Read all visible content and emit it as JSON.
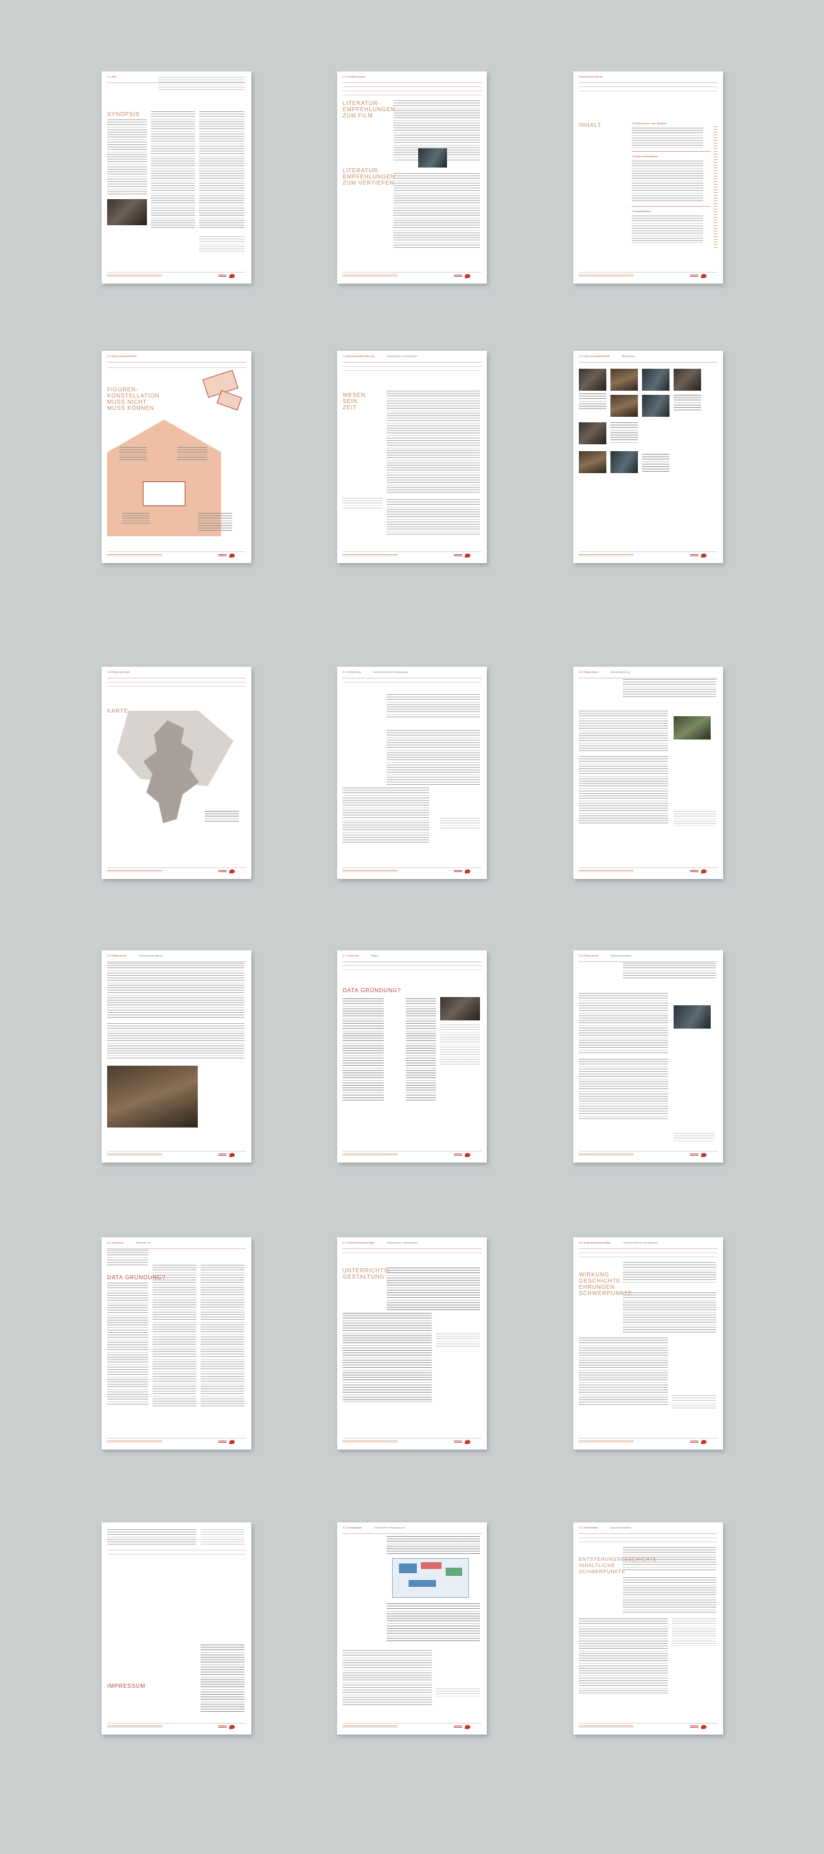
{
  "pages": [
    {
      "header": "1.1 Plot",
      "title": "SYNOPSIS",
      "title_color": "#c58a66"
    },
    {
      "header": "1.2 Empfehlungen",
      "title": "LITERATUR-\nEMPFEHLUNGEN\nZUM FILM",
      "title2": "LITERATUR-\nEMPFEHLUNGEN\nZUM VERTIEFEN"
    },
    {
      "header": "Unterrichtsmaterial",
      "title": "INHALT",
      "toc": [
        "1  Einführung in den Kinofilm",
        "2  Unterrichtsmaterial",
        "3  Arbeitsblätter"
      ]
    },
    {
      "header": "1.3 Figurenkonstellation",
      "title": "FIGUREN-\nKONSTELLATION\nMUSS NICHT\nMUSS KÖNNEN"
    },
    {
      "header": "1.4 Kurzcharakterisierung",
      "subheader": "Historischer Hintergrund",
      "title": "WESEN\nSEIN\nZEIT"
    },
    {
      "header": "1.5 Figurencharakteristik",
      "subheader": "Besetzung"
    },
    {
      "header": "1.6 Filmausschnitt",
      "title": "KARTE"
    },
    {
      "header": "2.1 Einführung",
      "subheader": "Geschichtlicher Hintergrund"
    },
    {
      "header": "2.2 Filmanalyse",
      "subheader": "Kameraführung"
    },
    {
      "header": "2.3 Filmanalyse",
      "subheader": "Unterrichtsmaterial"
    },
    {
      "header": "3.1 Interview",
      "subheader": "Regie",
      "title": "DATA GRÜNDUNG?"
    },
    {
      "header": "3.2 Filmanalyse",
      "subheader": "Figurencharakter"
    },
    {
      "header": "4.1 Interview",
      "subheader": "Hintergrund",
      "title": "DATA GRÜNDUNG?"
    },
    {
      "header": "4.2 Unterrichtsvorschläge",
      "subheader": "Historischer Hintergrund",
      "title": "UNTERRICHTS-\nGESTALTUNG"
    },
    {
      "header": "4.3 Unterrichtsvorschläge",
      "subheader": "Geschichtlicher Hintergrund",
      "title": "WIRKUNG\nGESCHICHTE\nEHRUNGEN\nSCHWERPUNKTE"
    },
    {
      "header": "",
      "title": "IMPRESSUM"
    },
    {
      "header": "5.1 Arbeitsblatt",
      "subheader": "Historischer Hintergrund"
    },
    {
      "header": "5.2 Arbeitsblatt",
      "subheader": "Figurencharakter",
      "title": "ENTSTEHUNGSGESCHICHTE\nINHALTLICHE\nSCHWERPUNKTE"
    }
  ]
}
